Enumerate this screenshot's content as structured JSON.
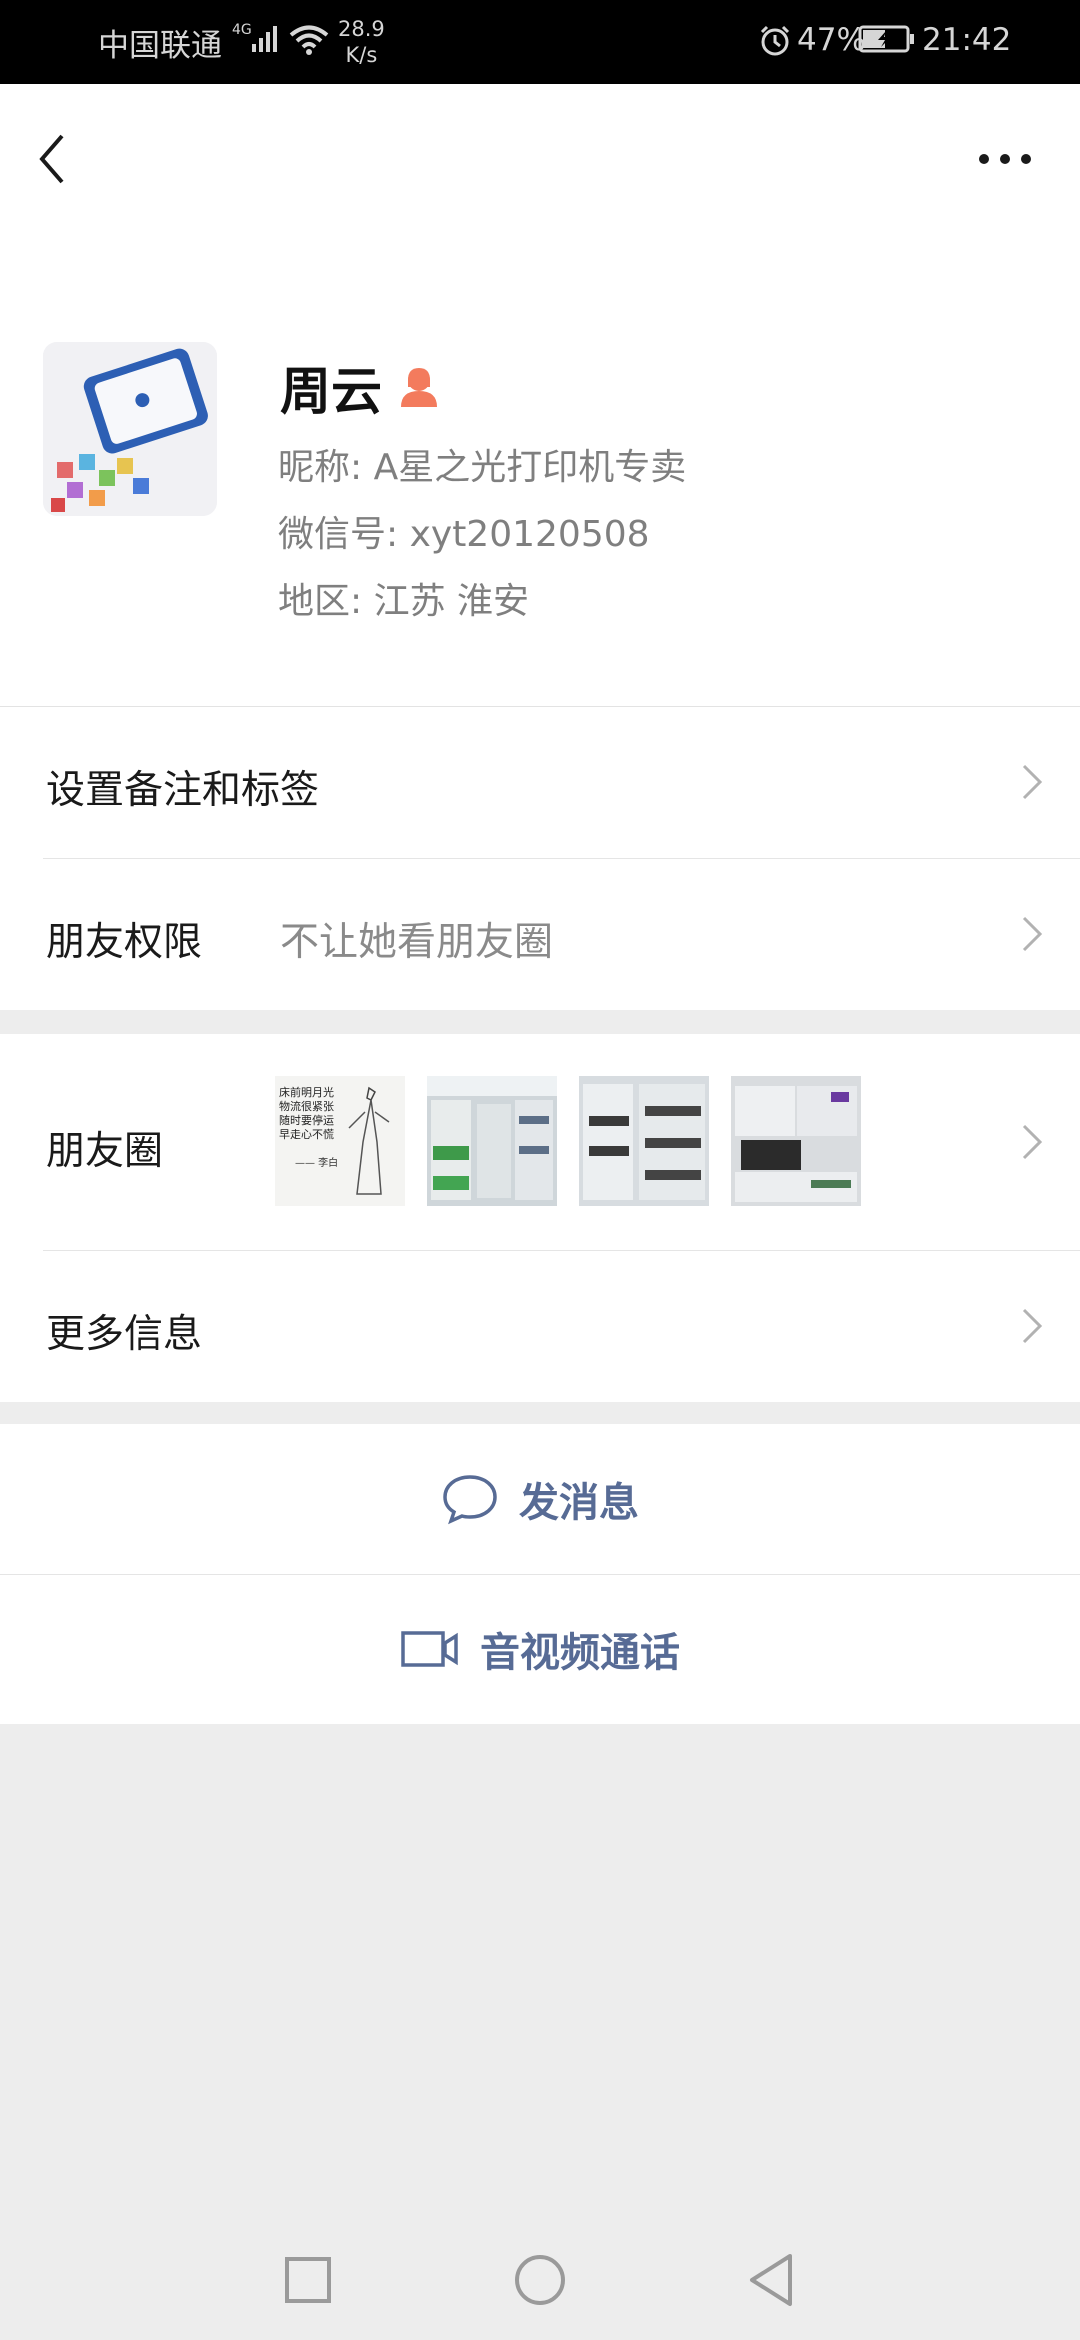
{
  "status_bar": {
    "carrier": "中国联通",
    "network_type": "4G",
    "speed_value": "28.9",
    "speed_unit": "K/s",
    "battery": "47%",
    "time": "21:42"
  },
  "header": {
    "back_icon": "chevron-left-icon",
    "more_icon": "more-dots-icon"
  },
  "profile": {
    "name": "周云",
    "gender_icon": "female-icon",
    "gender_color": "#f37b5d",
    "nickname_label": "昵称: ",
    "nickname": "A星之光打印机专卖",
    "wechat_id_label": "微信号: ",
    "wechat_id": "xyt20120508",
    "region_label": "地区: ",
    "region": "江苏  淮安"
  },
  "rows": {
    "remark": {
      "label": "设置备注和标签"
    },
    "permissions": {
      "label": "朋友权限",
      "value": "不让她看朋友圈"
    },
    "moments": {
      "label": "朋友圈"
    },
    "more_info": {
      "label": "更多信息"
    }
  },
  "moments_thumb_text": {
    "lines": [
      "床前明月光",
      "物流很紧张",
      "随时要停运",
      "早走心不慌"
    ],
    "signature": "—— 李白"
  },
  "actions": {
    "message": {
      "label": "发消息",
      "icon": "chat-bubble-icon"
    },
    "call": {
      "label": "音视频通话",
      "icon": "video-camera-icon"
    }
  },
  "colors": {
    "link": "#576b95",
    "background": "#ededed"
  }
}
